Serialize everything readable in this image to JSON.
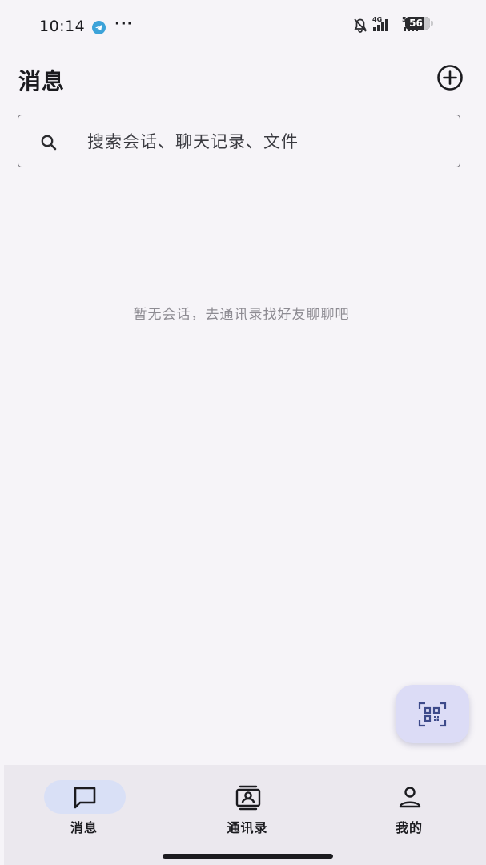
{
  "status_bar": {
    "time": "10:14",
    "more": "···",
    "net_4g": "4G",
    "net_5g": "5GA",
    "battery": "56"
  },
  "header": {
    "title": "消息"
  },
  "search": {
    "placeholder": "搜索会话、聊天记录、文件"
  },
  "empty_state": {
    "text": "暂无会话，去通讯录找好友聊聊吧"
  },
  "bottom_nav": {
    "items": [
      {
        "label": "消息",
        "icon": "chat-icon",
        "active": true
      },
      {
        "label": "通讯录",
        "icon": "contacts-icon",
        "active": false
      },
      {
        "label": "我的",
        "icon": "person-icon",
        "active": false
      }
    ]
  },
  "icons": {
    "add": "add-circle-icon",
    "search": "search-icon",
    "fab": "qr-scan-icon"
  },
  "colors": {
    "background": "#f6f4f8",
    "nav_background": "#ebe8ee",
    "active_pill": "#d9e0f6",
    "fab": "#dcdcf6",
    "accent_icon": "#3d4a8a"
  }
}
